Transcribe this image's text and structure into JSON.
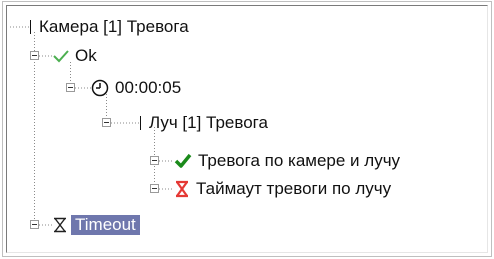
{
  "tree": {
    "nodes": [
      {
        "id": "camera",
        "label": "Камера [1] Тревога",
        "icon": "bar-icon",
        "expanded": true
      },
      {
        "id": "ok",
        "label": "Ok",
        "icon": "checkmark-icon",
        "icon_color": "#4caf50",
        "expanded": true
      },
      {
        "id": "timer",
        "label": "00:00:05",
        "icon": "clock-icon",
        "expanded": true
      },
      {
        "id": "beam",
        "label": "Луч [1] Тревога",
        "icon": "bar-icon",
        "expanded": true
      },
      {
        "id": "alarm-camera-beam",
        "label": "Тревога по камере и лучу",
        "icon": "checkmark-icon",
        "icon_color": "#1a8a1a",
        "expanded": true
      },
      {
        "id": "beam-timeout",
        "label": "Таймаут тревоги по лучу",
        "icon": "hourglass-icon",
        "icon_color": "#e53935",
        "expanded": true
      },
      {
        "id": "timeout",
        "label": "Timeout",
        "icon": "hourglass-icon",
        "icon_color": "#222222",
        "selected": true,
        "expanded": true
      }
    ]
  }
}
